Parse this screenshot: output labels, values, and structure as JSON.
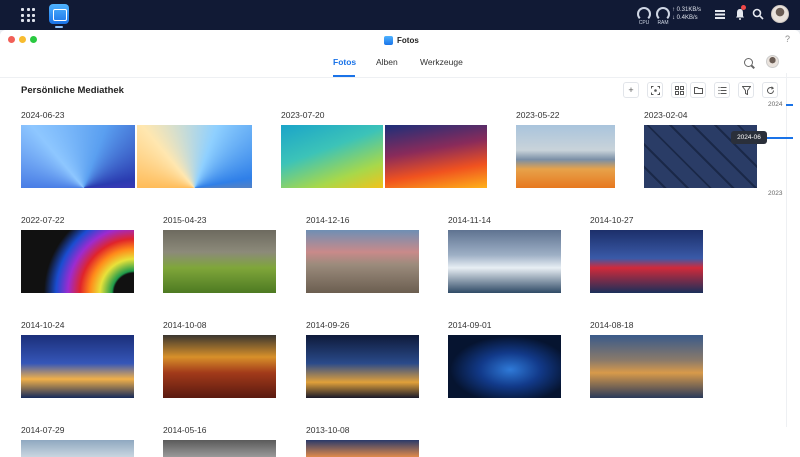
{
  "taskbar": {
    "cpu_label": "CPU",
    "ram_label": "RAM",
    "net_up": "↑ 0.31KB/s",
    "net_down": "↓ 0.4KB/s"
  },
  "window": {
    "title": "Fotos",
    "help": "?"
  },
  "tabs": [
    {
      "label": "Fotos",
      "active": true
    },
    {
      "label": "Alben",
      "active": false
    },
    {
      "label": "Werkzeuge",
      "active": false
    }
  ],
  "library_title": "Persönliche Mediathek",
  "toolbar": {
    "add_label": "+"
  },
  "groups": [
    {
      "date": "2024-06-23"
    },
    {
      "date": "2023-07-20"
    },
    {
      "date": "2023-05-22"
    },
    {
      "date": "2023-02-04"
    },
    {
      "date": "2022-07-22"
    },
    {
      "date": "2015-04-23"
    },
    {
      "date": "2014-12-16"
    },
    {
      "date": "2014-11-14"
    },
    {
      "date": "2014-10-27"
    },
    {
      "date": "2014-10-24"
    },
    {
      "date": "2014-10-08"
    },
    {
      "date": "2014-09-26"
    },
    {
      "date": "2014-09-01"
    },
    {
      "date": "2014-08-18"
    },
    {
      "date": "2014-07-29"
    },
    {
      "date": "2014-05-16"
    },
    {
      "date": "2013-10-08"
    }
  ],
  "timeline": {
    "year_top": "2024",
    "hover": "2024-06",
    "year_mid": "2023"
  },
  "colors": {
    "accent": "#1a73e8",
    "taskbar": "#111a35"
  }
}
